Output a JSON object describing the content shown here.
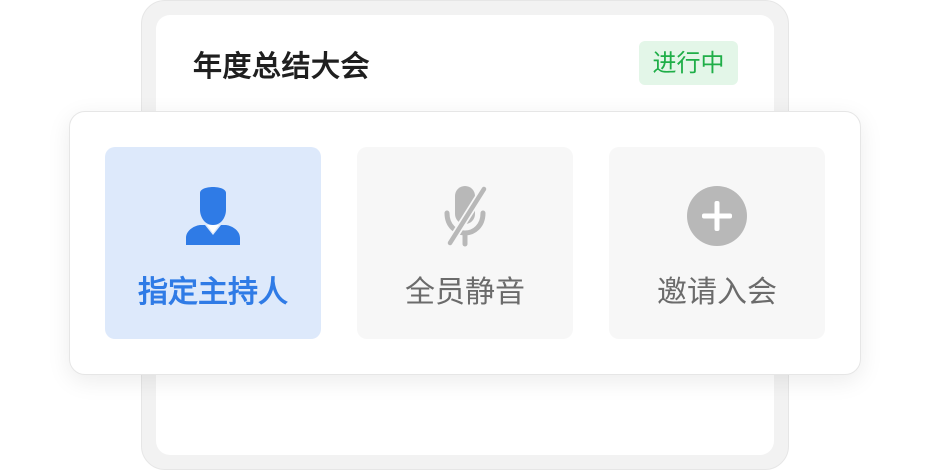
{
  "meeting": {
    "title": "年度总结大会",
    "status": "进行中"
  },
  "actions": [
    {
      "label": "指定主持人",
      "icon": "host-person-icon",
      "selected": true
    },
    {
      "label": "全员静音",
      "icon": "mic-muted-icon",
      "selected": false
    },
    {
      "label": "邀请入会",
      "icon": "plus-circle-icon",
      "selected": false
    }
  ],
  "colors": {
    "accent": "#2f7be6",
    "selected_bg": "#dde9fb",
    "status_text": "#1fae48",
    "status_bg": "#e3f6e8",
    "icon_gray": "#b8b8b8",
    "label_gray": "#6b6b6b"
  }
}
